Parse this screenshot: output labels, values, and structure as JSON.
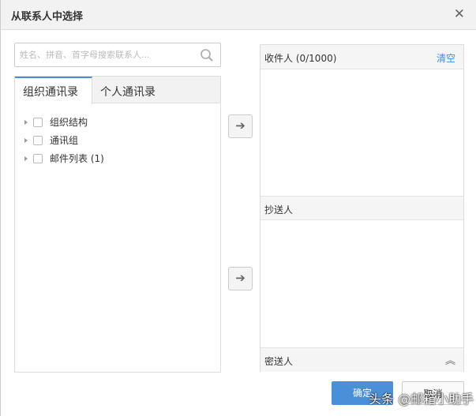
{
  "dialog": {
    "title": "从联系人中选择",
    "close_icon": "close-icon"
  },
  "search": {
    "placeholder": "姓名、拼音、首字母搜索联系人..."
  },
  "tabs": [
    {
      "label": "组织通讯录",
      "active": true
    },
    {
      "label": "个人通讯录",
      "active": false
    }
  ],
  "tree": [
    {
      "label": "组织结构"
    },
    {
      "label": "通讯组"
    },
    {
      "label": "邮件列表 (1)"
    }
  ],
  "recipients": {
    "to_label": "收件人 (0/1000)",
    "clear_label": "清空",
    "cc_label": "抄送人",
    "bcc_label": "密送人"
  },
  "buttons": {
    "ok": "确定",
    "cancel": "取消"
  },
  "watermark": "头条 @邮箱小助手",
  "colors": {
    "accent": "#4a90d9",
    "link": "#3a8ee6"
  }
}
